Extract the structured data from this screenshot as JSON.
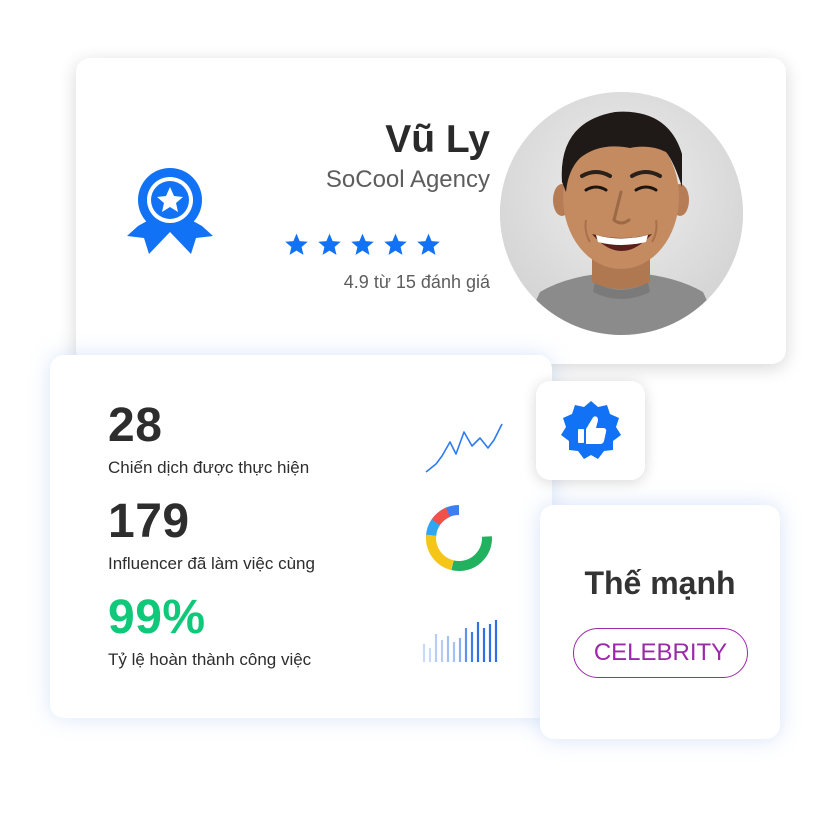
{
  "profile": {
    "name": "Vũ Ly",
    "agency": "SoCool Agency",
    "stars": 5,
    "rating_value": "4.9",
    "rating_word": "từ",
    "rating_count": "15",
    "rating_suffix": "đánh giá"
  },
  "stats": [
    {
      "value": "28",
      "label": "Chiến dịch được thực hiện",
      "chart": "line"
    },
    {
      "value": "179",
      "label": "Influencer đã làm việc cùng",
      "chart": "donut"
    },
    {
      "value": "99%",
      "label": "Tỷ lệ hoàn thành công việc",
      "chart": "bars"
    }
  ],
  "strength": {
    "title": "Thế mạnh",
    "tag": "CELEBRITY"
  },
  "icons": {
    "award": "award-ribbon-icon",
    "like": "thumbs-up-badge-icon",
    "star": "star-icon"
  },
  "colors": {
    "primary_blue": "#1272f5",
    "green": "#10c87a",
    "tag_purple": "#9b2aa8",
    "text_dark": "#2d2d2d",
    "text_gray": "#5d5d5d"
  }
}
